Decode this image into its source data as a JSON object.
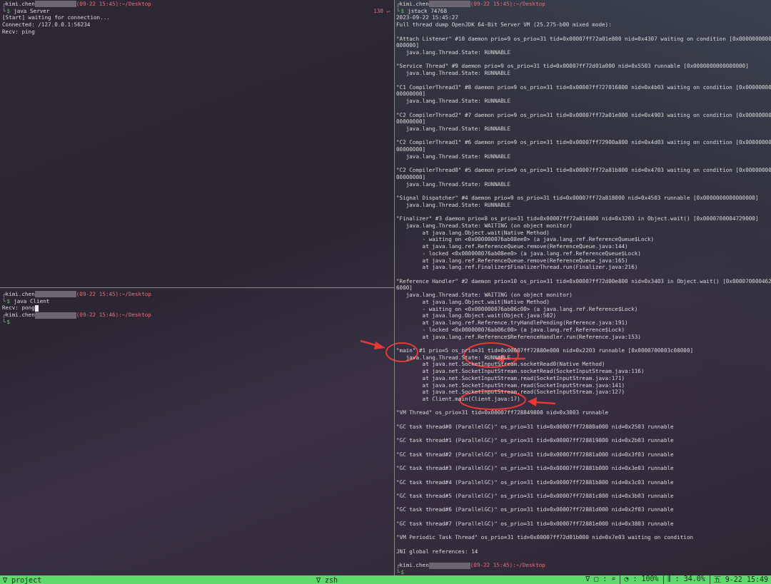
{
  "panes": [
    {
      "lines": [
        {
          "kind": "prompt",
          "corner": "╭",
          "user": "kimi.chen",
          "redacted": true,
          "time_path": "(09-22 15:45):~/Desktop"
        },
        {
          "kind": "command",
          "corner": "╰",
          "symbol": "$",
          "text": "java Server",
          "status": "130 ↵"
        },
        {
          "kind": "output",
          "text": "[Start] waiting for connection..."
        },
        {
          "kind": "output",
          "text": "Connected: /127.0.0.1:56234"
        },
        {
          "kind": "output",
          "text": "Recv: ping"
        }
      ]
    },
    {
      "lines": [
        {
          "kind": "prompt",
          "corner": "╭",
          "user": "kimi.chen",
          "redacted": true,
          "time_path": "(09-22 15:45):~/Desktop"
        },
        {
          "kind": "command",
          "corner": "╰",
          "symbol": "$",
          "text": "java Client"
        },
        {
          "kind": "output",
          "text": "Recv: pong",
          "cursor": true
        },
        {
          "kind": "prompt",
          "corner": "╭",
          "user": "kimi.chen",
          "redacted": true,
          "time_path": "(09-22 15:46):~/Desktop"
        },
        {
          "kind": "command",
          "corner": "╰",
          "symbol": "$"
        }
      ]
    },
    {
      "lines": [
        {
          "kind": "prompt",
          "corner": "╭",
          "user": "kimi.chen",
          "redacted": true,
          "time_path": "(09-22 15:45):~/Desktop"
        },
        {
          "kind": "command",
          "corner": "╰",
          "symbol": "$",
          "text": "jstack 74768"
        },
        {
          "kind": "output",
          "text": "2023-09-22 15:45:27"
        },
        {
          "kind": "output",
          "text": "Full thread dump OpenJDK 64-Bit Server VM (25.275-b00 mixed mode):"
        },
        {
          "kind": "blank"
        },
        {
          "kind": "output",
          "text": "\"Attach Listener\" #10 daemon prio=9 os_prio=31 tid=0x00007ff72a01e800 nid=0x4307 waiting on condition [0x0000000000"
        },
        {
          "kind": "output",
          "text": "000000]"
        },
        {
          "kind": "output",
          "text": "   java.lang.Thread.State: RUNNABLE"
        },
        {
          "kind": "blank"
        },
        {
          "kind": "output",
          "text": "\"Service Thread\" #9 daemon prio=9 os_prio=31 tid=0x00007ff72d01a000 nid=0x5503 runnable [0x0000000000000000]"
        },
        {
          "kind": "output",
          "text": "   java.lang.Thread.State: RUNNABLE"
        },
        {
          "kind": "blank"
        },
        {
          "kind": "output",
          "text": "\"C1 CompilerThread3\" #8 daemon prio=9 os_prio=31 tid=0x00007ff727016800 nid=0x4b03 waiting on condition [0x00000000"
        },
        {
          "kind": "output",
          "text": "00000000]"
        },
        {
          "kind": "output",
          "text": "   java.lang.Thread.State: RUNNABLE"
        },
        {
          "kind": "blank"
        },
        {
          "kind": "output",
          "text": "\"C2 CompilerThread2\" #7 daemon prio=9 os_prio=31 tid=0x00007ff72a01e000 nid=0x4903 waiting on condition [0x00000000"
        },
        {
          "kind": "output",
          "text": "00000000]"
        },
        {
          "kind": "output",
          "text": "   java.lang.Thread.State: RUNNABLE"
        },
        {
          "kind": "blank"
        },
        {
          "kind": "output",
          "text": "\"C2 CompilerThread1\" #6 daemon prio=9 os_prio=31 tid=0x00007ff72900a800 nid=0x4d03 waiting on condition [0x00000000"
        },
        {
          "kind": "output",
          "text": "00000000]"
        },
        {
          "kind": "output",
          "text": "   java.lang.Thread.State: RUNNABLE"
        },
        {
          "kind": "blank"
        },
        {
          "kind": "output",
          "text": "\"C2 CompilerThread0\" #5 daemon prio=9 os_prio=31 tid=0x00007ff72a81b800 nid=0x4703 waiting on condition [0x00000000"
        },
        {
          "kind": "output",
          "text": "00000000]"
        },
        {
          "kind": "output",
          "text": "   java.lang.Thread.State: RUNNABLE"
        },
        {
          "kind": "blank"
        },
        {
          "kind": "output",
          "text": "\"Signal Dispatcher\" #4 daemon prio=9 os_prio=31 tid=0x00007ff72a818000 nid=0x4503 runnable [0x0000000000000000]"
        },
        {
          "kind": "output",
          "text": "   java.lang.Thread.State: RUNNABLE"
        },
        {
          "kind": "blank"
        },
        {
          "kind": "output",
          "text": "\"Finalizer\" #3 daemon prio=8 os_prio=31 tid=0x00007ff72a816800 nid=0x3203 in Object.wait() [0x0000700004729000]"
        },
        {
          "kind": "output",
          "text": "   java.lang.Thread.State: WAITING (on object monitor)"
        },
        {
          "kind": "output",
          "text": "        at java.lang.Object.wait(Native Method)"
        },
        {
          "kind": "output",
          "text": "        - waiting on <0x000000076ab08ee0> (a java.lang.ref.ReferenceQueue$Lock)"
        },
        {
          "kind": "output",
          "text": "        at java.lang.ref.ReferenceQueue.remove(ReferenceQueue.java:144)"
        },
        {
          "kind": "output",
          "text": "        - locked <0x000000076ab08ee0> (a java.lang.ref.ReferenceQueue$Lock)"
        },
        {
          "kind": "output",
          "text": "        at java.lang.ref.ReferenceQueue.remove(ReferenceQueue.java:165)"
        },
        {
          "kind": "output",
          "text": "        at java.lang.ref.Finalizer$FinalizerThread.run(Finalizer.java:216)"
        },
        {
          "kind": "blank"
        },
        {
          "kind": "output",
          "text": "\"Reference Handler\" #2 daemon prio=10 os_prio=31 tid=0x00007ff72d00e800 nid=0x3403 in Object.wait() [0x000070000462"
        },
        {
          "kind": "output",
          "text": "6000]"
        },
        {
          "kind": "output",
          "text": "   java.lang.Thread.State: WAITING (on object monitor)"
        },
        {
          "kind": "output",
          "text": "        at java.lang.Object.wait(Native Method)"
        },
        {
          "kind": "output",
          "text": "        - waiting on <0x000000076ab06c00> (a java.lang.ref.Reference$Lock)"
        },
        {
          "kind": "output",
          "text": "        at java.lang.Object.wait(Object.java:502)"
        },
        {
          "kind": "output",
          "text": "        at java.lang.ref.Reference.tryHandlePending(Reference.java:191)"
        },
        {
          "kind": "output",
          "text": "        - locked <0x000000076ab06c00> (a java.lang.ref.Reference$Lock)"
        },
        {
          "kind": "output",
          "text": "        at java.lang.ref.Reference$ReferenceHandler.run(Reference.java:153)"
        },
        {
          "kind": "blank"
        },
        {
          "kind": "output",
          "text": "\"main\" #1 prio=5 os_prio=31 tid=0x00007ff72880e000 nid=0x2203 runnable [0x0000700003c08000]"
        },
        {
          "kind": "output",
          "text": "   java.lang.Thread.State: RUNNABLE"
        },
        {
          "kind": "output",
          "text": "        at java.net.SocketInputStream.socketRead0(Native Method)"
        },
        {
          "kind": "output",
          "text": "        at java.net.SocketInputStream.socketRead(SocketInputStream.java:116)"
        },
        {
          "kind": "output",
          "text": "        at java.net.SocketInputStream.read(SocketInputStream.java:171)"
        },
        {
          "kind": "output",
          "text": "        at java.net.SocketInputStream.read(SocketInputStream.java:141)"
        },
        {
          "kind": "output",
          "text": "        at java.net.SocketInputStream.read(SocketInputStream.java:127)"
        },
        {
          "kind": "output",
          "text": "        at Client.main(Client.java:17)"
        },
        {
          "kind": "blank"
        },
        {
          "kind": "output",
          "text": "\"VM Thread\" os_prio=31 tid=0x00007ff728849800 nid=0x3003 runnable"
        },
        {
          "kind": "blank"
        },
        {
          "kind": "output",
          "text": "\"GC task thread#0 (ParallelGC)\" os_prio=31 tid=0x00007ff72880a000 nid=0x2503 runnable"
        },
        {
          "kind": "blank"
        },
        {
          "kind": "output",
          "text": "\"GC task thread#1 (ParallelGC)\" os_prio=31 tid=0x00007ff728819800 nid=0x2b03 runnable"
        },
        {
          "kind": "blank"
        },
        {
          "kind": "output",
          "text": "\"GC task thread#2 (ParallelGC)\" os_prio=31 tid=0x00007ff72881a000 nid=0x3f03 runnable"
        },
        {
          "kind": "blank"
        },
        {
          "kind": "output",
          "text": "\"GC task thread#3 (ParallelGC)\" os_prio=31 tid=0x00007ff72881b000 nid=0x3e03 runnable"
        },
        {
          "kind": "blank"
        },
        {
          "kind": "output",
          "text": "\"GC task thread#4 (ParallelGC)\" os_prio=31 tid=0x00007ff72881b800 nid=0x3c03 runnable"
        },
        {
          "kind": "blank"
        },
        {
          "kind": "output",
          "text": "\"GC task thread#5 (ParallelGC)\" os_prio=31 tid=0x00007ff72881c800 nid=0x3b03 runnable"
        },
        {
          "kind": "blank"
        },
        {
          "kind": "output",
          "text": "\"GC task thread#6 (ParallelGC)\" os_prio=31 tid=0x00007ff72881d000 nid=0x2f03 runnable"
        },
        {
          "kind": "blank"
        },
        {
          "kind": "output",
          "text": "\"GC task thread#7 (ParallelGC)\" os_prio=31 tid=0x00007ff72881e000 nid=0x3803 runnable"
        },
        {
          "kind": "blank"
        },
        {
          "kind": "output",
          "text": "\"VM Periodic Task Thread\" os_prio=31 tid=0x00007ff72d01b000 nid=0x7e03 waiting on condition"
        },
        {
          "kind": "blank"
        },
        {
          "kind": "output",
          "text": "JNI global references: 14"
        },
        {
          "kind": "blank"
        },
        {
          "kind": "prompt",
          "corner": "╭",
          "user": "kimi.chen",
          "redacted": true,
          "time_path": "(09-22 15:45):~/Desktop"
        },
        {
          "kind": "command",
          "corner": "╰",
          "symbol": "$"
        }
      ]
    }
  ],
  "status_bar": {
    "left": "∇ project",
    "center": "∇ zsh",
    "right": [
      "∇ □ : ⌕",
      "◔ : 100%",
      "⫼ : 34.0%",
      "五 9-22 15:49"
    ]
  }
}
